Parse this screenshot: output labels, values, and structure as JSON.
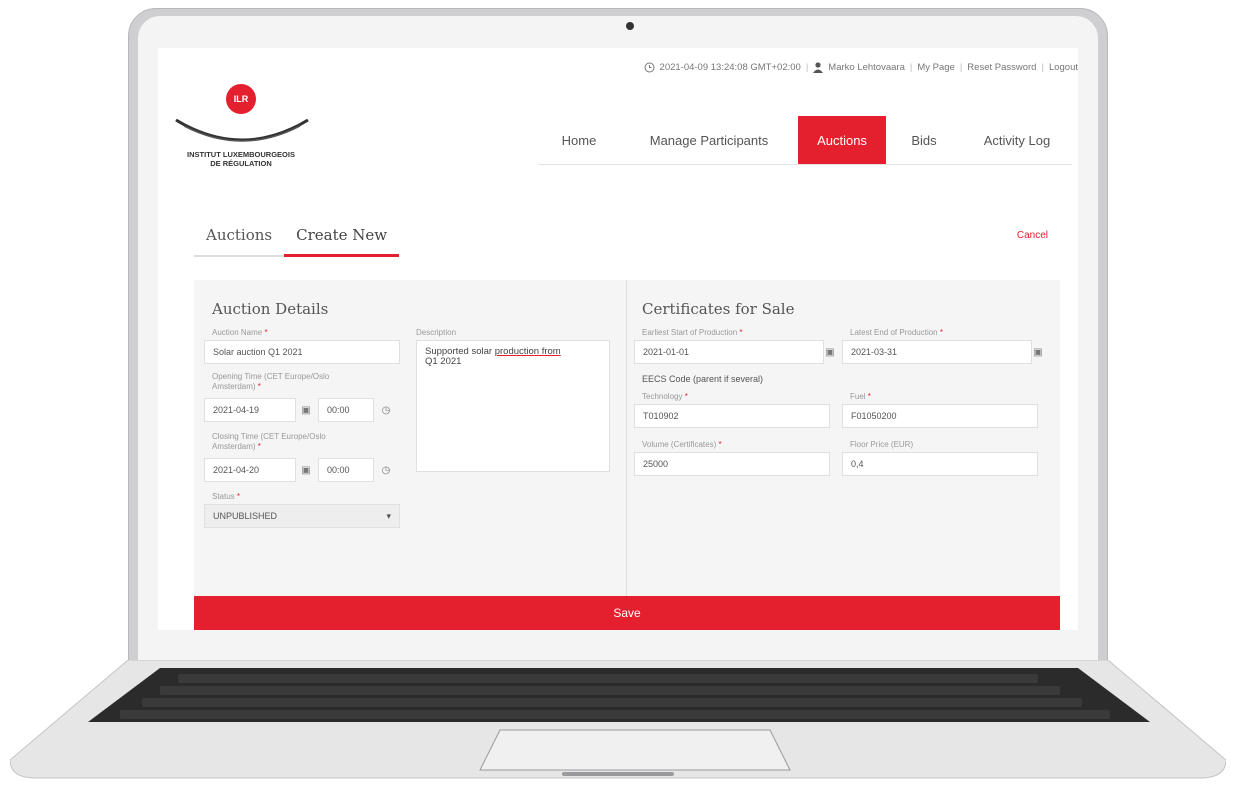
{
  "logo": {
    "badge": "ILR",
    "line1": "INSTITUT LUXEMBOURGEOIS",
    "line2": "DE RÉGULATION"
  },
  "topbar": {
    "datetime": "2021-04-09 13:24:08 GMT+02:00",
    "user": "Marko Lehtovaara",
    "links": [
      "My Page",
      "Reset Password",
      "Logout"
    ]
  },
  "nav": {
    "items": [
      "Home",
      "Manage Participants",
      "Auctions",
      "Bids",
      "Activity Log"
    ],
    "active": "Auctions"
  },
  "subtabs": {
    "items": [
      "Auctions",
      "Create New"
    ],
    "active": "Create New",
    "cancel": "Cancel"
  },
  "auction_details": {
    "title": "Auction Details",
    "name_label": "Auction Name",
    "name_value": "Solar auction Q1 2021",
    "description_label": "Description",
    "description_plain": "Supported solar ",
    "description_underlined": "production from",
    "description_line2": "Q1 2021",
    "opening_label_1": "Opening Time (CET Europe/Oslo",
    "opening_label_2": "Amsterdam)",
    "opening_date": "2021-04-19",
    "opening_time": "00:00",
    "closing_label_1": "Closing Time (CET Europe/Oslo",
    "closing_label_2": "Amsterdam)",
    "closing_date": "2021-04-20",
    "closing_time": "00:00",
    "status_label": "Status",
    "status_value": "UNPUBLISHED"
  },
  "certificates": {
    "title": "Certificates for Sale",
    "earliest_label": "Earliest Start of Production",
    "earliest_value": "2021-01-01",
    "latest_label": "Latest End of Production",
    "latest_value": "2021-03-31",
    "eecs_label": "EECS Code (parent if several)",
    "technology_label": "Technology",
    "technology_value": "T010902",
    "fuel_label": "Fuel",
    "fuel_value": "F01050200",
    "volume_label": "Volume (Certificates)",
    "volume_value": "25000",
    "floor_label": "Floor Price (EUR)",
    "floor_value": "0,4"
  },
  "save_label": "Save",
  "colors": {
    "accent": "#e5202e"
  }
}
